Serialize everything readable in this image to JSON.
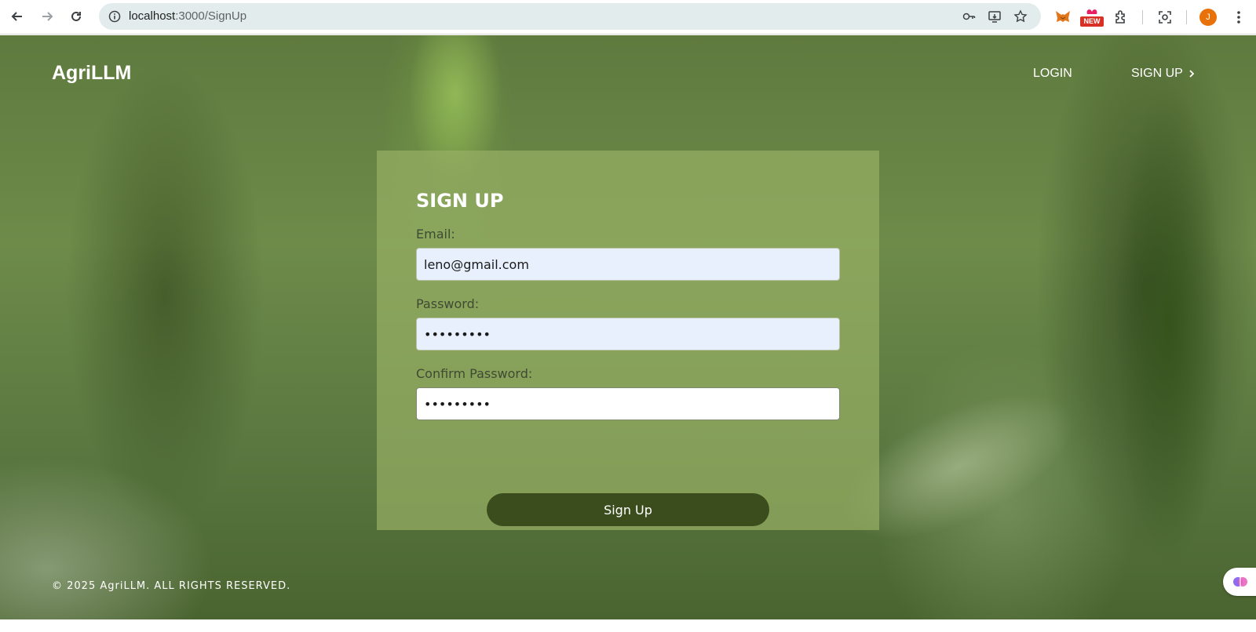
{
  "browser": {
    "url_host": "localhost",
    "url_path": ":3000/SignUp",
    "profile_initial": "J",
    "new_badge": "NEW"
  },
  "header": {
    "brand": "AgriLLM",
    "login_label": "LOGIN",
    "signup_label": "SIGN UP"
  },
  "form": {
    "title": "SIGN UP",
    "email_label": "Email:",
    "email_value": "leno@gmail.com",
    "password_label": "Password:",
    "password_value": "•••••••••",
    "confirm_label": "Confirm Password:",
    "confirm_value": "•••••••••",
    "submit_label": "Sign Up"
  },
  "footer": {
    "copyright": "© 2025 AgriLLM. ALL RIGHTS RESERVED."
  },
  "colors": {
    "button_bg": "#3b4d1c",
    "card_bg": "rgba(150,175,100,0.72)",
    "autofill_bg": "#e8f0fe"
  }
}
